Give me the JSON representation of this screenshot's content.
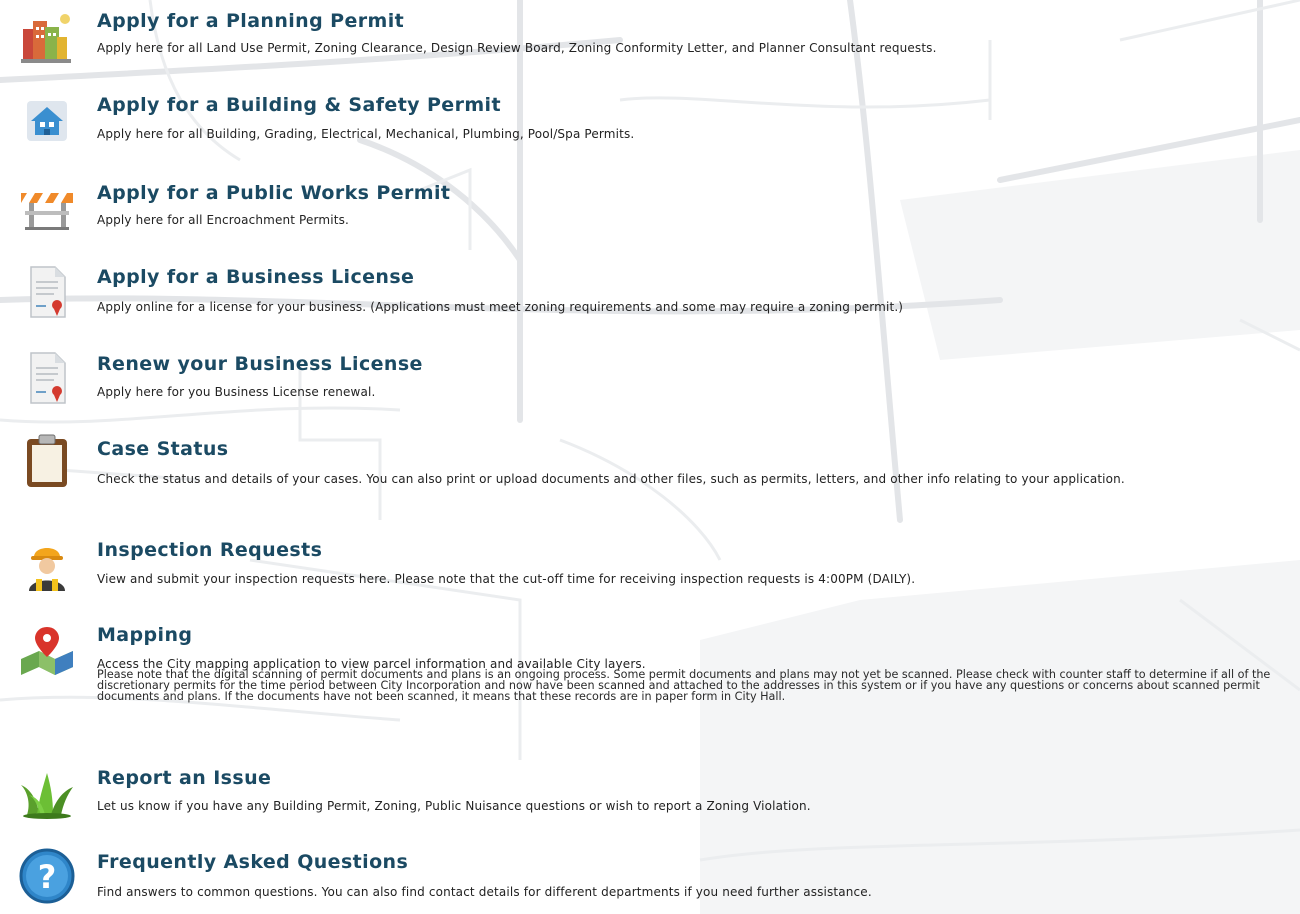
{
  "services": [
    {
      "icon": "buildings-icon",
      "title": "Apply for a Planning Permit",
      "description": "Apply here for all Land Use Permit, Zoning Clearance, Design Review Board, Zoning Conformity Letter, and Planner Consultant requests."
    },
    {
      "icon": "house-icon",
      "title": "Apply for a Building & Safety Permit",
      "description": "Apply here for all Building, Grading, Electrical, Mechanical, Plumbing, Pool/Spa Permits."
    },
    {
      "icon": "barricade-icon",
      "title": "Apply for a Public Works Permit",
      "description": "Apply here for all Encroachment Permits."
    },
    {
      "icon": "license-document-icon",
      "title": "Apply for a Business License",
      "description": "Apply online for a license for your business. (Applications must meet zoning requirements and some may require a zoning permit.)"
    },
    {
      "icon": "license-document-icon",
      "title": "Renew your Business License",
      "description": "Apply here for you Business License renewal."
    },
    {
      "icon": "clipboard-icon",
      "title": "Case Status",
      "description": "Check the status and details of your cases. You can also print or upload documents and other files, such as permits, letters, and other info relating to your application."
    },
    {
      "icon": "inspector-icon",
      "title": "Inspection Requests",
      "description": "View and submit your inspection requests here. Please note that the cut-off time for receiving inspection requests is 4:00PM (DAILY)."
    },
    {
      "icon": "map-pin-icon",
      "title": "Mapping",
      "description": "Access the City mapping application to view parcel information and available City layers.",
      "note": "Please note that the digital scanning of permit documents and plans is an ongoing process. Some permit documents and plans may not yet be scanned. Please check with counter staff to determine if all of the discretionary permits for the time period between City Incorporation and now have been scanned and attached to the addresses in this system or if you have any questions or concerns about scanned permit documents and plans. If the documents have not been scanned, it means that these records are in paper form in City Hall."
    },
    {
      "icon": "grass-icon",
      "title": "Report an Issue",
      "description": "Let us know if you have any Building Permit, Zoning, Public Nuisance questions or wish to report a Zoning Violation."
    },
    {
      "icon": "question-icon",
      "title": "Frequently Asked Questions",
      "description": "Find answers to common questions. You can also find contact details for different departments if you need further assistance."
    }
  ],
  "colors": {
    "title": "#1b4a63",
    "text": "#222222",
    "map_lines": "#e2e4e6"
  }
}
